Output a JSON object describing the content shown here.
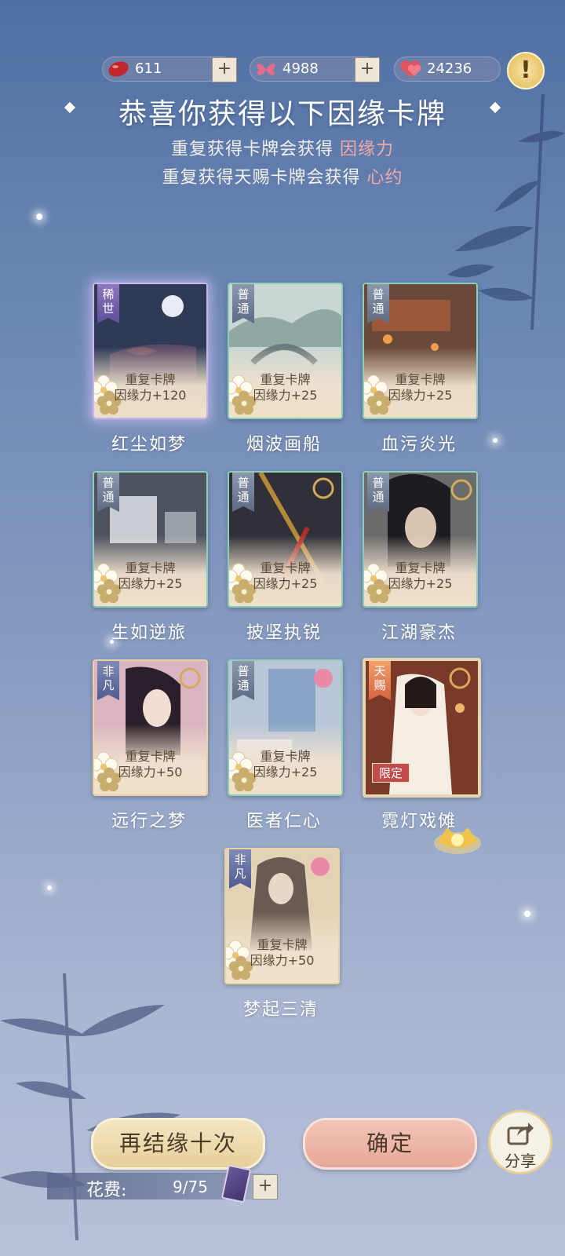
{
  "currencies": [
    {
      "icon": "red-bean-icon",
      "value": "611"
    },
    {
      "icon": "butterfly-icon",
      "value": "4988"
    },
    {
      "icon": "heart-icon",
      "value": "24236"
    }
  ],
  "header": {
    "title": "恭喜你获得以下因缘卡牌",
    "line1_prefix": "重复获得卡牌会获得",
    "line1_highlight": "因缘力",
    "line2_prefix": "重复获得天赐卡牌会获得",
    "line2_highlight": "心约"
  },
  "colors": {
    "highlight": "#f2a8a8",
    "confirm": "#e8a89a",
    "again": "#e6cf98"
  },
  "cards": [
    {
      "name": "红尘如梦",
      "tag": "稀世",
      "dup_label": "重复卡牌",
      "reward": "因缘力+120"
    },
    {
      "name": "烟波画船",
      "tag": "普通",
      "dup_label": "重复卡牌",
      "reward": "因缘力+25"
    },
    {
      "name": "血污炎光",
      "tag": "普通",
      "dup_label": "重复卡牌",
      "reward": "因缘力+25"
    },
    {
      "name": "生如逆旅",
      "tag": "普通",
      "dup_label": "重复卡牌",
      "reward": "因缘力+25"
    },
    {
      "name": "披坚执锐",
      "tag": "普通",
      "dup_label": "重复卡牌",
      "reward": "因缘力+25"
    },
    {
      "name": "江湖豪杰",
      "tag": "普通",
      "dup_label": "重复卡牌",
      "reward": "因缘力+25"
    },
    {
      "name": "远行之梦",
      "tag": "非凡",
      "dup_label": "重复卡牌",
      "reward": "因缘力+50"
    },
    {
      "name": "医者仁心",
      "tag": "普通",
      "dup_label": "重复卡牌",
      "reward": "因缘力+25"
    },
    {
      "name": "霓灯戏傩",
      "tag": "天赐",
      "limited": "限定"
    },
    {
      "name": "梦起三清",
      "tag": "非凡",
      "dup_label": "重复卡牌",
      "reward": "因缘力+50"
    }
  ],
  "actions": {
    "again": "再结缘十次",
    "confirm": "确定",
    "share": "分享"
  },
  "cost": {
    "label": "花费:",
    "value": "9/75"
  }
}
